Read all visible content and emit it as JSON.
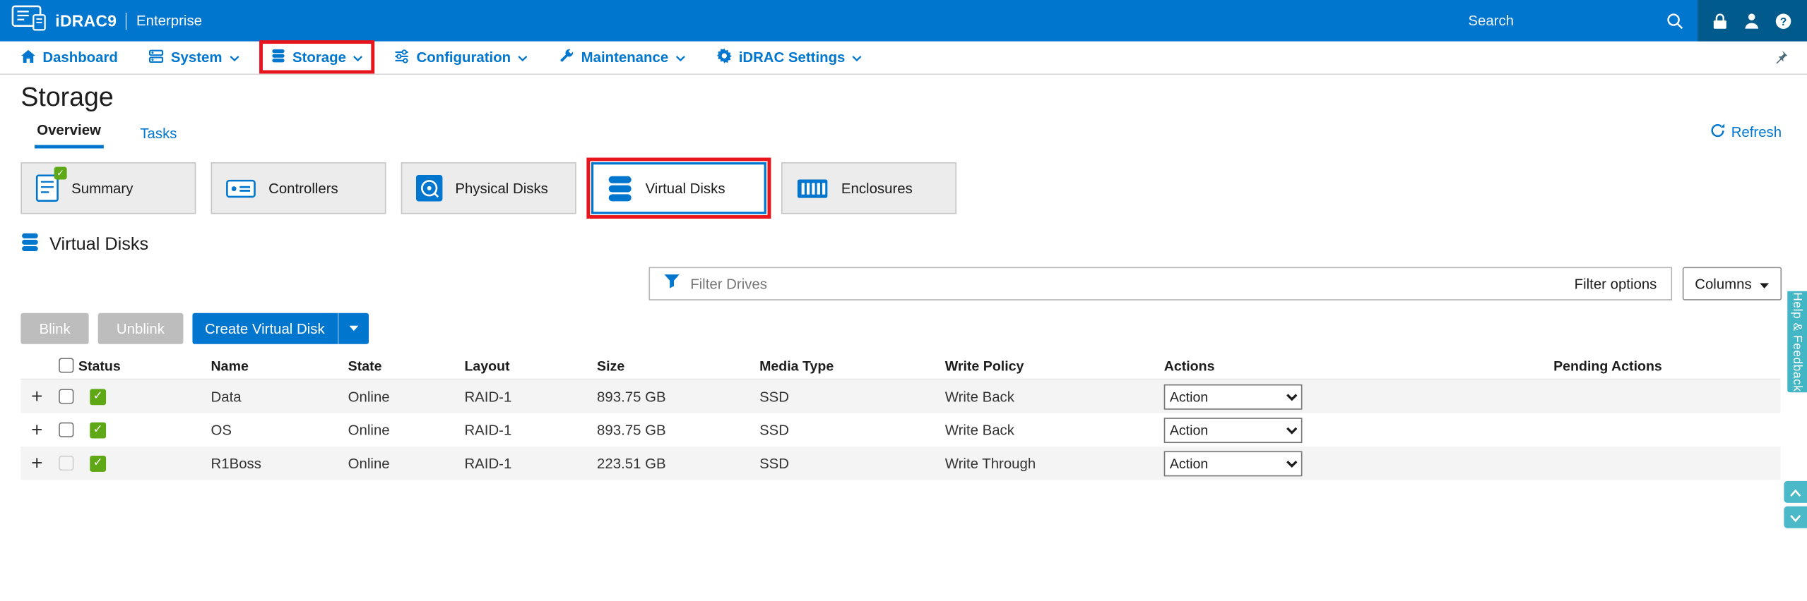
{
  "header": {
    "product": "iDRAC9",
    "edition": "Enterprise",
    "search": {
      "placeholder": "Search"
    }
  },
  "nav": {
    "items": [
      {
        "label": "Dashboard"
      },
      {
        "label": "System"
      },
      {
        "label": "Storage"
      },
      {
        "label": "Configuration"
      },
      {
        "label": "Maintenance"
      },
      {
        "label": "iDRAC Settings"
      }
    ]
  },
  "page": {
    "title": "Storage",
    "tabs": [
      {
        "label": "Overview"
      },
      {
        "label": "Tasks"
      }
    ],
    "refresh_label": "Refresh"
  },
  "tiles": [
    {
      "label": "Summary"
    },
    {
      "label": "Controllers"
    },
    {
      "label": "Physical Disks"
    },
    {
      "label": "Virtual Disks"
    },
    {
      "label": "Enclosures"
    }
  ],
  "section": {
    "title": "Virtual Disks"
  },
  "toolbar": {
    "filter_placeholder": "Filter Drives",
    "filter_options_label": "Filter options",
    "columns_label": "Columns",
    "blink_label": "Blink",
    "unblink_label": "Unblink",
    "create_label": "Create Virtual Disk"
  },
  "table": {
    "headers": {
      "status": "Status",
      "name": "Name",
      "state": "State",
      "layout": "Layout",
      "size": "Size",
      "media_type": "Media Type",
      "write_policy": "Write Policy",
      "actions": "Actions",
      "pending_actions": "Pending Actions"
    },
    "action_option": "Action",
    "rows": [
      {
        "name": "Data",
        "state": "Online",
        "layout": "RAID-1",
        "size": "893.75 GB",
        "media_type": "SSD",
        "write_policy": "Write Back"
      },
      {
        "name": "OS",
        "state": "Online",
        "layout": "RAID-1",
        "size": "893.75 GB",
        "media_type": "SSD",
        "write_policy": "Write Back"
      },
      {
        "name": "R1Boss",
        "state": "Online",
        "layout": "RAID-1",
        "size": "223.51 GB",
        "media_type": "SSD",
        "write_policy": "Write Through"
      }
    ]
  },
  "side": {
    "help_label": "Help & Feedback"
  },
  "colors": {
    "header_blue": "#0076ce",
    "header_icons_blue": "#005a8c",
    "accent_blue": "#0076ce",
    "status_green": "#5ea715",
    "annotation_red": "#e8151d",
    "help_teal": "#43b6c6",
    "row_alt_gray": "#f4f4f4",
    "tile_gray": "#ececec",
    "disabled_button_gray": "#bdbdbd"
  }
}
